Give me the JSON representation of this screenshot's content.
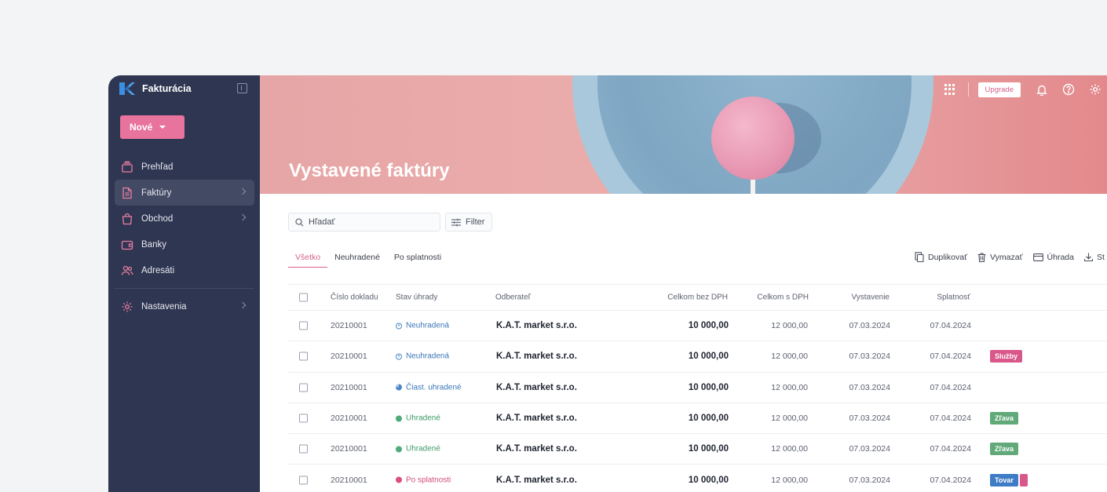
{
  "sidebar": {
    "app_name": "Fakturácia",
    "new_button": "Nové",
    "items": [
      {
        "label": "Prehľad",
        "icon": "archive-icon"
      },
      {
        "label": "Faktúry",
        "icon": "document-icon",
        "active": true
      },
      {
        "label": "Obchod",
        "icon": "shopping-bag-icon"
      },
      {
        "label": "Banky",
        "icon": "wallet-icon"
      },
      {
        "label": "Adresáti",
        "icon": "users-icon"
      },
      {
        "label": "Nastavenia",
        "icon": "gear-icon"
      }
    ]
  },
  "header": {
    "title": "Vystavené faktúry",
    "upgrade": "Upgrade"
  },
  "toolbar": {
    "search_placeholder": "Hľadať",
    "filter": "Filter"
  },
  "tabs": [
    "Všetko",
    "Neuhradené",
    "Po splatnosti"
  ],
  "actions": {
    "duplicate": "Duplikovať",
    "delete": "Vymazať",
    "payment": "Úhrada",
    "download": "St"
  },
  "table": {
    "columns": [
      "Číslo dokladu",
      "Stav úhrady",
      "Odberateľ",
      "Celkom bez DPH",
      "Celkom s DPH",
      "Vystavenie",
      "Splatnosť"
    ],
    "rows": [
      {
        "num": "20210001",
        "status": "Neuhradená",
        "client": "K.A.T. market s.r.o.",
        "bez": "10 000,00",
        "s": "12 000,00",
        "vys": "07.03.2024",
        "spl": "07.04.2024",
        "tag": ""
      },
      {
        "num": "20210001",
        "status": "Neuhradená",
        "client": "K.A.T. market s.r.o.",
        "bez": "10 000,00",
        "s": "12 000,00",
        "vys": "07.03.2024",
        "spl": "07.04.2024",
        "tag": "Služby"
      },
      {
        "num": "20210001",
        "status": "Čiast. uhradené",
        "client": "K.A.T. market s.r.o.",
        "bez": "10 000,00",
        "s": "12 000,00",
        "vys": "07.03.2024",
        "spl": "07.04.2024",
        "tag": ""
      },
      {
        "num": "20210001",
        "status": "Uhradené",
        "client": "K.A.T. market s.r.o.",
        "bez": "10 000,00",
        "s": "12 000,00",
        "vys": "07.03.2024",
        "spl": "07.04.2024",
        "tag": "Zľava"
      },
      {
        "num": "20210001",
        "status": "Uhradené",
        "client": "K.A.T. market s.r.o.",
        "bez": "10 000,00",
        "s": "12 000,00",
        "vys": "07.03.2024",
        "spl": "07.04.2024",
        "tag": "Zľava"
      },
      {
        "num": "20210001",
        "status": "Po splatnosti",
        "client": "K.A.T. market s.r.o.",
        "bez": "10 000,00",
        "s": "12 000,00",
        "vys": "07.03.2024",
        "spl": "07.04.2024",
        "tag": "Tovar"
      }
    ]
  },
  "colors": {
    "sidebar": "#2f3651",
    "accent": "#e8739c",
    "status_open": "#3d76b8",
    "status_paid": "#3e9a69",
    "status_overdue": "#d24f7b"
  }
}
